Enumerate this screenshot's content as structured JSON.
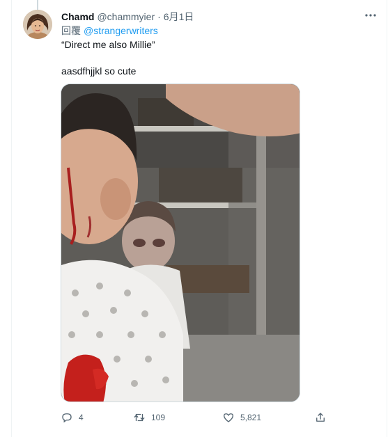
{
  "tweet": {
    "author": {
      "display_name": "Chamd",
      "handle": "@chammyier"
    },
    "separator": "·",
    "date": "6月1日",
    "reply_prefix": "回覆",
    "reply_to": "@strangerwriters",
    "text_line1": "“Direct me also Millie”",
    "text_line2": "aasdfhjjkl so cute",
    "media": {
      "icon": "photo"
    },
    "actions": {
      "replies": "4",
      "retweets": "109",
      "likes": "5,821"
    }
  },
  "icons": {
    "more": "more-icon",
    "reply": "reply-icon",
    "retweet": "retweet-icon",
    "like": "heart-icon",
    "share": "share-icon"
  },
  "colors": {
    "link": "#1d9bf0",
    "muted": "#536471",
    "text": "#0f1419",
    "border": "#cfd9de"
  }
}
